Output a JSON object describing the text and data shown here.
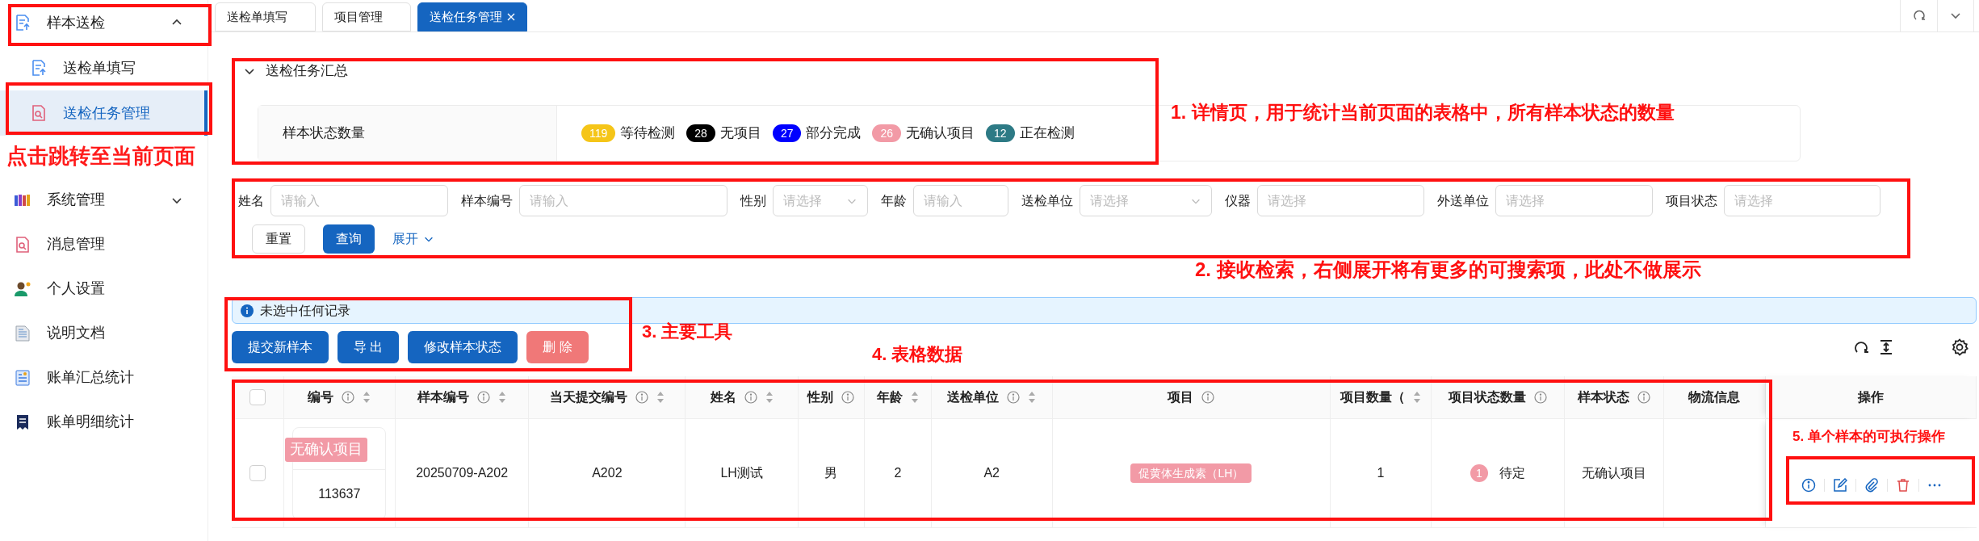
{
  "sidebar": {
    "items": [
      {
        "label": "样本送检",
        "kind": "group",
        "expanded": true,
        "children": [
          {
            "label": "送检单填写",
            "selected": false
          },
          {
            "label": "送检任务管理",
            "selected": true
          }
        ]
      },
      {
        "label": "系统管理",
        "kind": "group",
        "expanded": false
      },
      {
        "label": "消息管理",
        "kind": "link"
      },
      {
        "label": "个人设置",
        "kind": "link"
      },
      {
        "label": "说明文档",
        "kind": "link"
      },
      {
        "label": "账单汇总统计",
        "kind": "link"
      },
      {
        "label": "账单明细统计",
        "kind": "link"
      }
    ]
  },
  "tabs": [
    {
      "label": "送检单填写",
      "selected": false
    },
    {
      "label": "项目管理",
      "selected": false
    },
    {
      "label": "送检任务管理",
      "selected": true
    }
  ],
  "summary": {
    "title": "送检任务汇总",
    "expanded": true,
    "label": "样本状态数量",
    "statuses": [
      {
        "count": "119",
        "label": "等待检测",
        "color": "#f5c518"
      },
      {
        "count": "28",
        "label": "无项目",
        "color": "#000000"
      },
      {
        "count": "27",
        "label": "部分完成",
        "color": "#0000ff"
      },
      {
        "count": "26",
        "label": "无确认项目",
        "color": "#f29aa6"
      },
      {
        "count": "12",
        "label": "正在检测",
        "color": "#2d7a85"
      }
    ]
  },
  "filters": [
    {
      "label": "姓名",
      "placeholder": "请输入",
      "kind": "input"
    },
    {
      "label": "样本编号",
      "placeholder": "请输入",
      "kind": "input"
    },
    {
      "label": "性别",
      "placeholder": "请选择",
      "kind": "select"
    },
    {
      "label": "年龄",
      "placeholder": "请输入",
      "kind": "input"
    },
    {
      "label": "送检单位",
      "placeholder": "请选择",
      "kind": "select"
    },
    {
      "label": "仪器",
      "placeholder": "请选择",
      "kind": "input"
    },
    {
      "label": "外送单位",
      "placeholder": "请选择",
      "kind": "input"
    },
    {
      "label": "项目状态",
      "placeholder": "请选择",
      "kind": "input"
    }
  ],
  "filter_buttons": {
    "reset": "重置",
    "search": "查询",
    "expand": {
      "label": "展开",
      "expanded": false
    }
  },
  "alert": "未选中任何记录",
  "toolbar": [
    {
      "label": "提交新样本",
      "kind": "primary"
    },
    {
      "label": "导 出",
      "kind": "primary"
    },
    {
      "label": "修改样本状态",
      "kind": "primary"
    },
    {
      "label": "删 除",
      "kind": "danger"
    }
  ],
  "table": {
    "select_all": {
      "checked": false
    },
    "columns": [
      {
        "label": "编号",
        "info": true,
        "sortable": true
      },
      {
        "label": "样本编号",
        "info": true,
        "sortable": true
      },
      {
        "label": "当天提交编号",
        "info": true,
        "sortable": true
      },
      {
        "label": "姓名",
        "info": true,
        "sortable": true
      },
      {
        "label": "性别",
        "info": true,
        "sortable": false
      },
      {
        "label": "年龄",
        "info": false,
        "sortable": true
      },
      {
        "label": "送检单位",
        "info": true,
        "sortable": true
      },
      {
        "label": "项目",
        "info": true,
        "sortable": false
      },
      {
        "label": "项目数量（",
        "info": false,
        "sortable": true
      },
      {
        "label": "项目状态数量",
        "info": true,
        "sortable": false
      },
      {
        "label": "样本状态",
        "info": true,
        "sortable": false
      },
      {
        "label": "物流信息",
        "info": false,
        "sortable": false
      },
      {
        "label": "操作",
        "info": false,
        "sortable": false
      }
    ],
    "rows": [
      {
        "selected": false,
        "cells": [
          {
            "kind": "id",
            "tag": "无确认项目",
            "value": "113637"
          },
          {
            "kind": "text",
            "value": "20250709-A202"
          },
          {
            "kind": "text",
            "value": "A202"
          },
          {
            "kind": "text",
            "value": "LH测试"
          },
          {
            "kind": "text",
            "value": "男"
          },
          {
            "kind": "text",
            "value": "2"
          },
          {
            "kind": "text",
            "value": "A2"
          },
          {
            "kind": "tags",
            "tags": [
              "促黄体生成素（LH）"
            ]
          },
          {
            "kind": "text",
            "value": "1"
          },
          {
            "kind": "status",
            "count": "1",
            "value": "待定"
          },
          {
            "kind": "text",
            "value": "无确认项目"
          }
        ]
      }
    ]
  },
  "annotations": [
    {
      "text": "点击跳转至当前页面"
    },
    {
      "text": "1. 详情页，用于统计当前页面的表格中，所有样本状态的数量"
    },
    {
      "text": "2. 接收检索，右侧展开将有更多的可搜索项，此处不做展示"
    },
    {
      "text": "3. 主要工具"
    },
    {
      "text": "4. 表格数据"
    },
    {
      "text": "5. 单个样本的可执行操作"
    }
  ]
}
